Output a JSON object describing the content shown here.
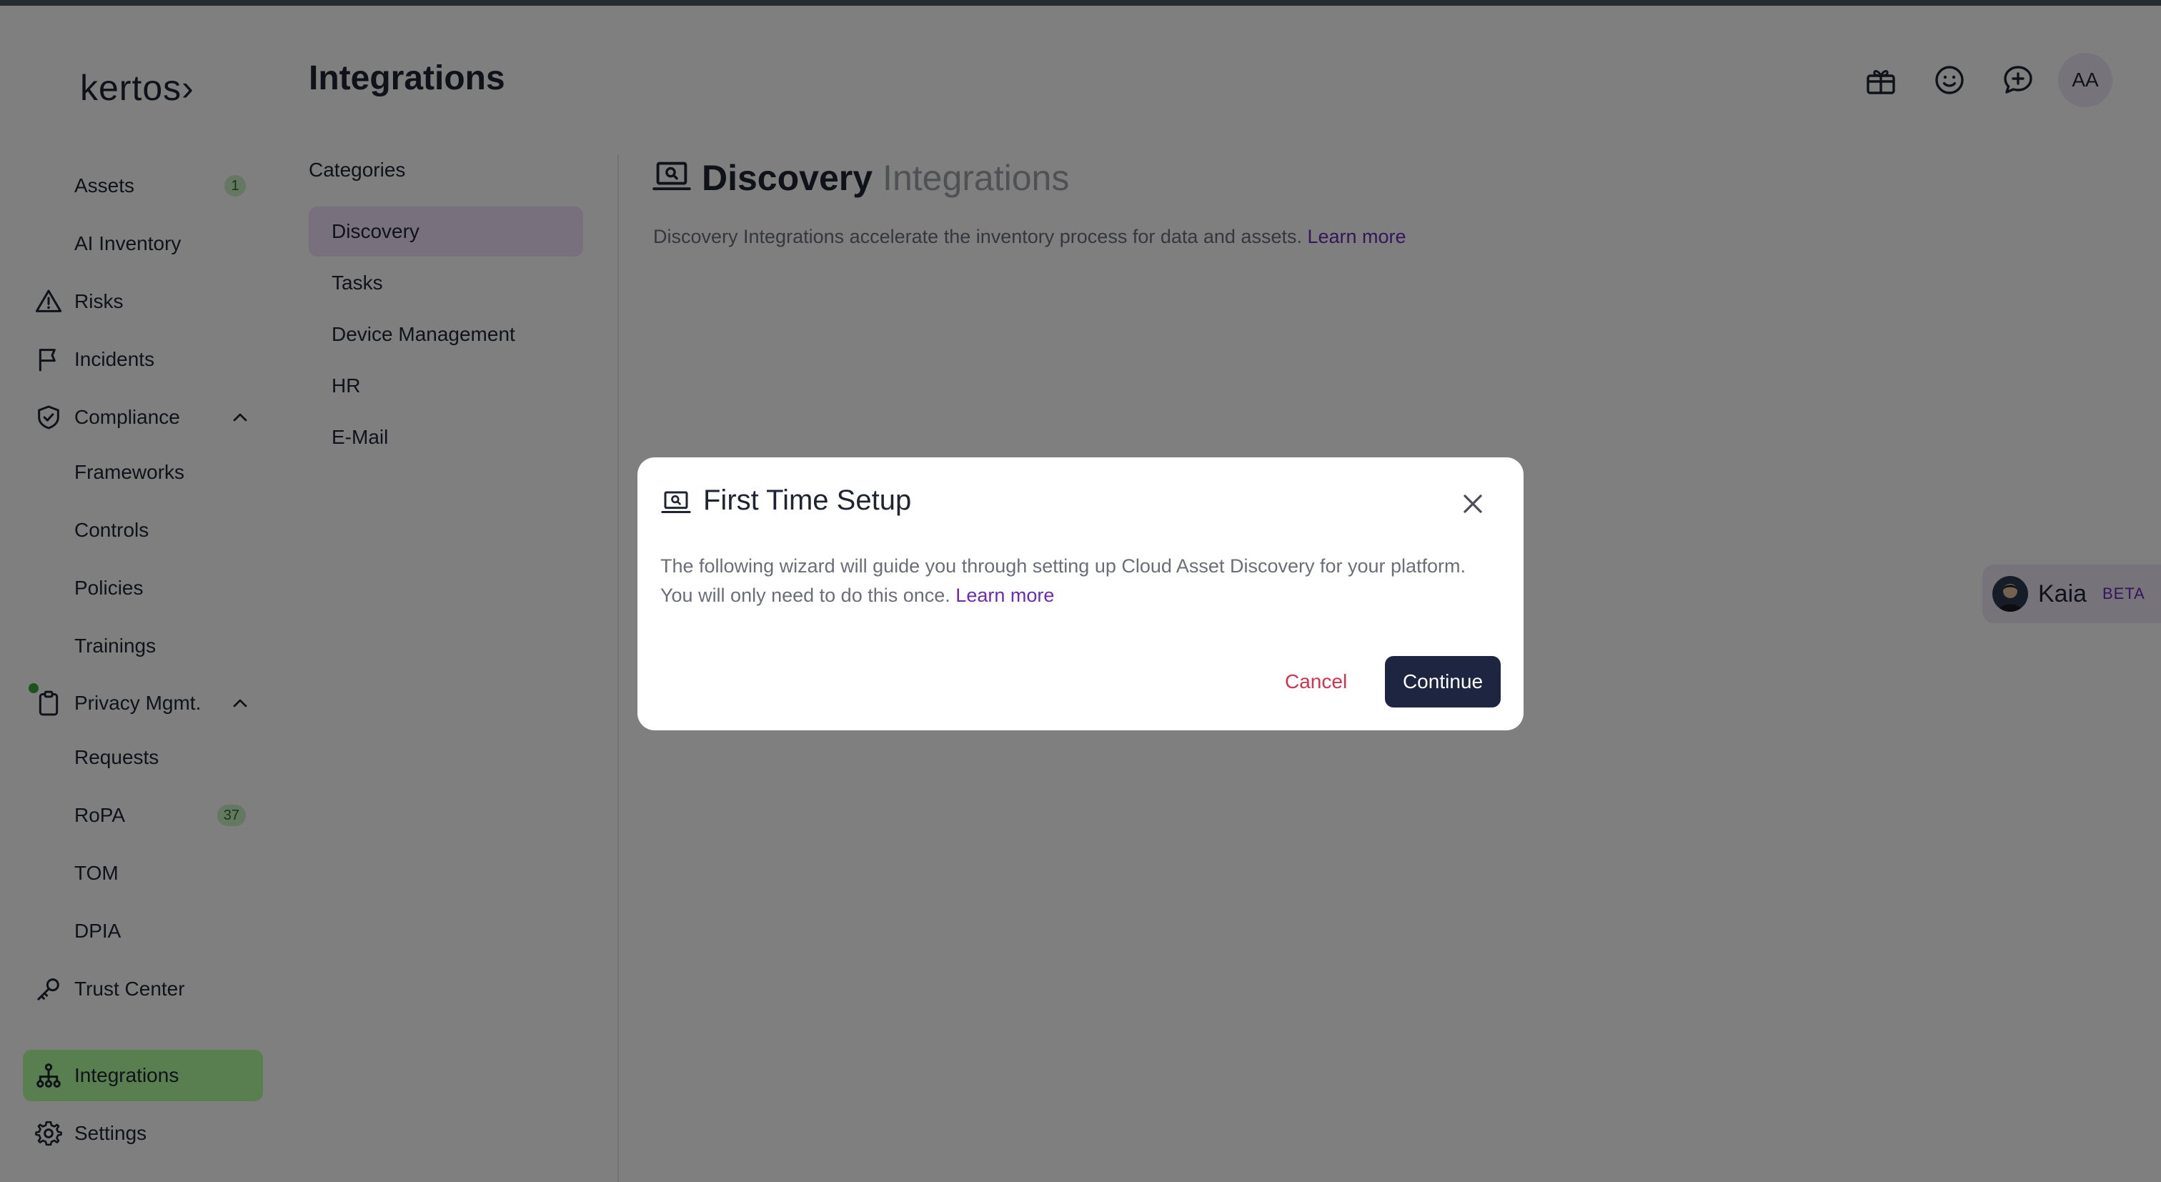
{
  "app": {
    "logo": "kertos›"
  },
  "sidebar": {
    "items": [
      {
        "label": "Assets",
        "badge": "1"
      },
      {
        "label": "AI Inventory"
      },
      {
        "label": "Risks"
      },
      {
        "label": "Incidents"
      },
      {
        "label": "Compliance"
      },
      {
        "label": "Frameworks"
      },
      {
        "label": "Controls"
      },
      {
        "label": "Policies"
      },
      {
        "label": "Trainings"
      },
      {
        "label": "Privacy Mgmt."
      },
      {
        "label": "Requests"
      },
      {
        "label": "RoPA",
        "badge": "37"
      },
      {
        "label": "TOM"
      },
      {
        "label": "DPIA"
      },
      {
        "label": "Trust Center"
      },
      {
        "label": "Integrations"
      },
      {
        "label": "Settings"
      }
    ]
  },
  "header": {
    "title": "Integrations",
    "icons": [
      "gift-icon",
      "smiley-icon",
      "chat-plus-icon"
    ],
    "avatar": "AA"
  },
  "categories": {
    "title": "Categories",
    "items": [
      "Discovery",
      "Tasks",
      "Device Management",
      "HR",
      "E-Mail"
    ]
  },
  "content": {
    "title": "Discovery",
    "title_muted": "Integrations",
    "description": "Discovery Integrations accelerate the inventory process for data and assets.",
    "learn_more": "Learn more"
  },
  "kaia": {
    "name": "Kaia",
    "badge": "BETA"
  },
  "modal": {
    "title": "First Time Setup",
    "text_line1": "The following wizard will guide you through setting up Cloud Asset Discovery for your platform.",
    "text_line2": "You will only need to do this once.",
    "learn_more": "Learn more",
    "cancel": "Cancel",
    "continue": "Continue"
  },
  "colors": {
    "accent_purple": "#6b2bb5",
    "active_green": "#b3ffa3",
    "primary_button": "#1d2540",
    "cancel_red": "#d2334f"
  }
}
